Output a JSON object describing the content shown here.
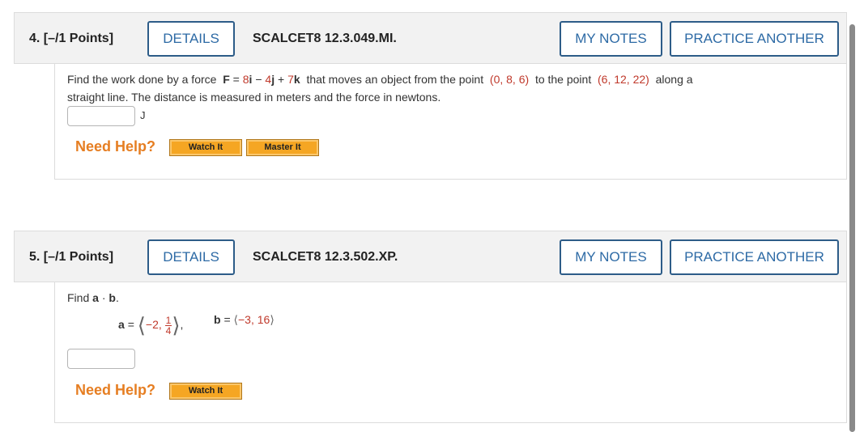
{
  "questions": [
    {
      "number": "4. [–/1 Points]",
      "details": "DETAILS",
      "id": "SCALCET8 12.3.049.MI.",
      "my_notes": "MY NOTES",
      "practice": "PRACTICE ANOTHER",
      "text_line1_a": "Find the work done by a force",
      "force_symbol": "F",
      "eq": "=",
      "c1": "8",
      "i": "i",
      "minus": "−",
      "c2": "4",
      "j": "j",
      "plus": "+",
      "c3": "7",
      "k": "k",
      "text_line1_b": "that moves an object from the point",
      "point1": "(0, 8, 6)",
      "text_line1_c": "to the point",
      "point2": "(6, 12, 22)",
      "text_line1_d": "along a",
      "text_line2": "straight line. The distance is measured in meters and the force in newtons.",
      "unit": "J",
      "need_help": "Need Help?",
      "watch": "Watch It",
      "master": "Master It"
    },
    {
      "number": "5. [–/1 Points]",
      "details": "DETAILS",
      "id": "SCALCET8 12.3.502.XP.",
      "my_notes": "MY NOTES",
      "practice": "PRACTICE ANOTHER",
      "find": "Find",
      "a": "a",
      "dot": "·",
      "b": "b",
      "period": ".",
      "a_eq": "a =",
      "a_first": "−2,",
      "frac_num": "1",
      "frac_den": "4",
      "comma": ",",
      "b_eq": "b =",
      "b_vals": "−3, 16",
      "need_help": "Need Help?",
      "watch": "Watch It"
    }
  ],
  "icons": [
    "left-angle-bracket",
    "right-angle-bracket"
  ]
}
